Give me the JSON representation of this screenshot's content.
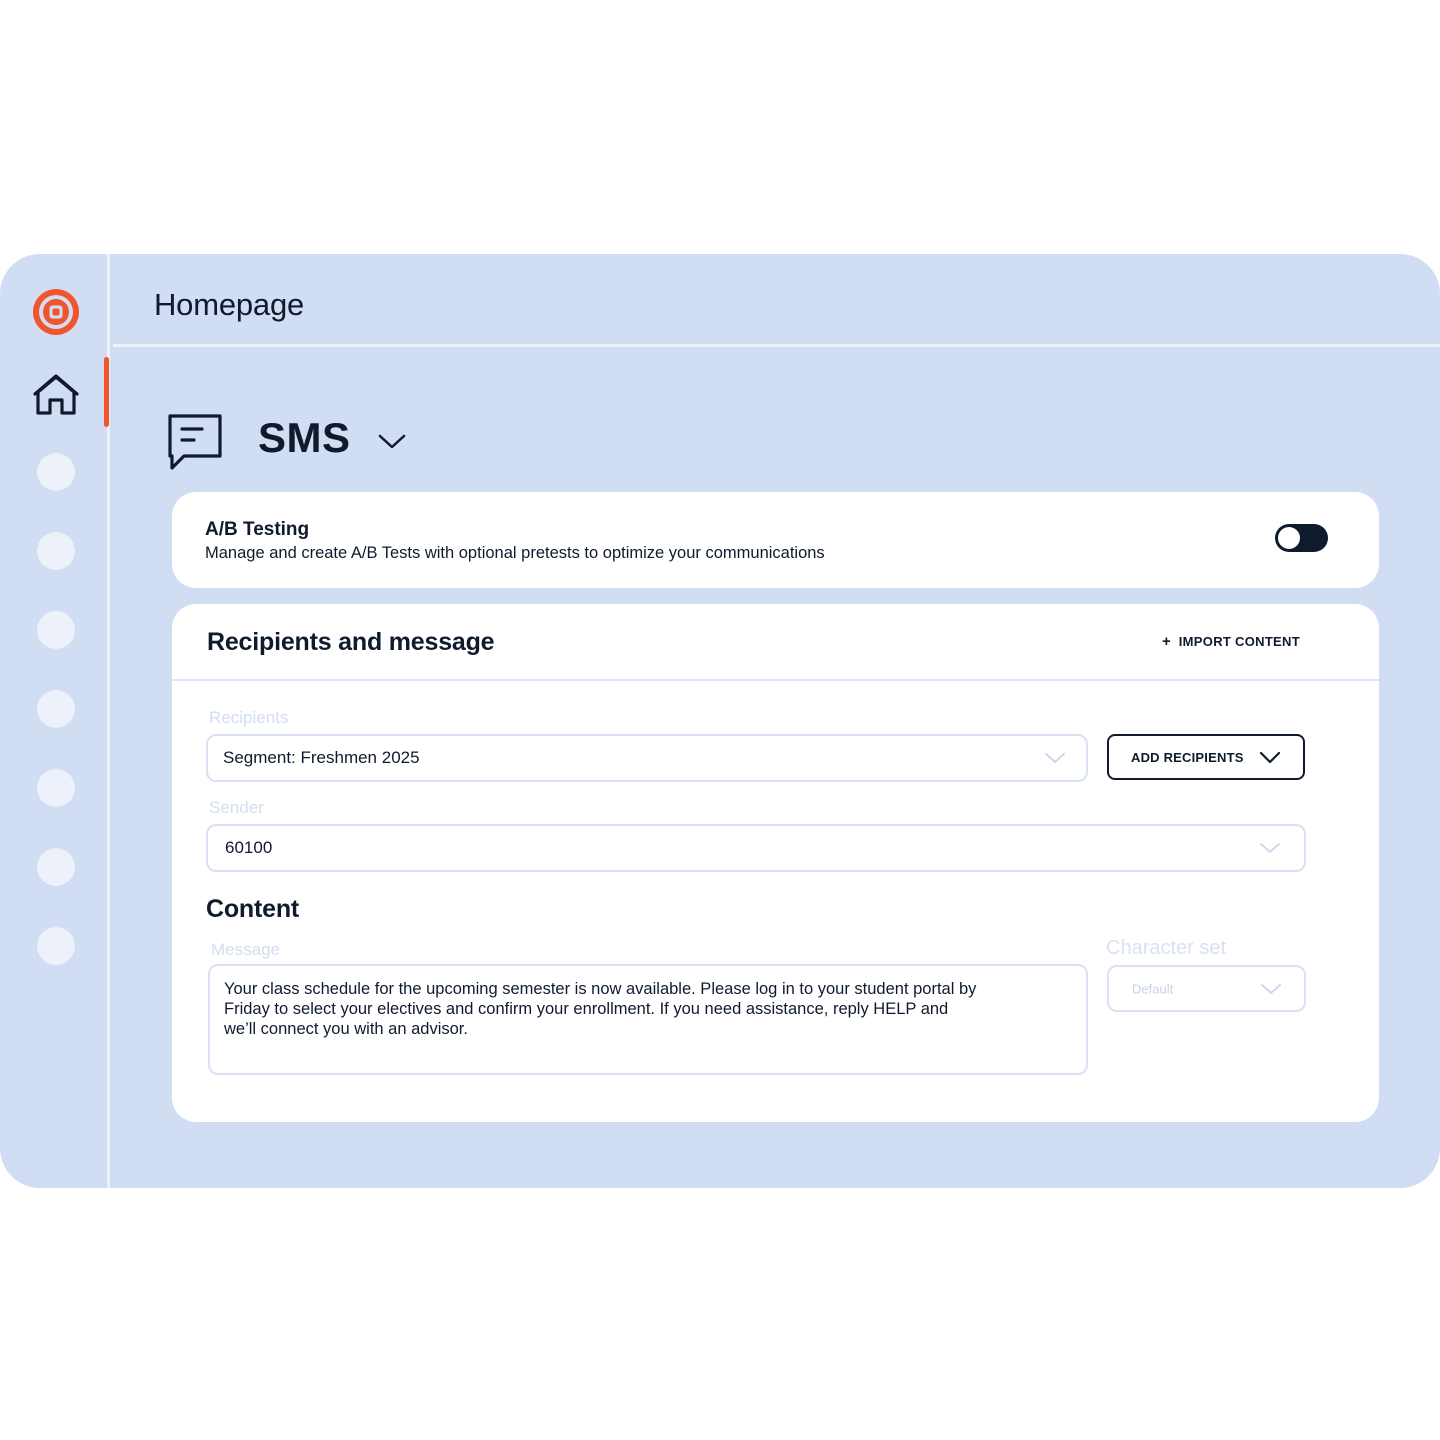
{
  "colors": {
    "frame_bg": "#d1ddf2",
    "accent": "#f0562b",
    "ink": "#0f1b2d",
    "card_bg": "#ffffff",
    "muted": "#d3def0"
  },
  "sidebar": {
    "logo_icon": "target-logo-icon",
    "items": [
      {
        "icon": "home-icon",
        "active": true
      },
      {
        "icon": "placeholder-dot"
      },
      {
        "icon": "placeholder-dot"
      },
      {
        "icon": "placeholder-dot"
      },
      {
        "icon": "placeholder-dot"
      },
      {
        "icon": "placeholder-dot"
      },
      {
        "icon": "placeholder-dot"
      },
      {
        "icon": "placeholder-dot"
      }
    ]
  },
  "header": {
    "title": "Homepage"
  },
  "channel": {
    "icon": "message-square-icon",
    "name": "SMS"
  },
  "ab_testing": {
    "title": "A/B Testing",
    "description": "Manage and create A/B Tests with optional pretests to optimize your communications",
    "enabled": false
  },
  "recipients_card": {
    "title": "Recipients and message",
    "import_button": {
      "icon": "+",
      "label": "IMPORT CONTENT"
    },
    "recipients": {
      "label": "Recipients",
      "value": "Segment: Freshmen 2025"
    },
    "add_recipients_label": "ADD RECIPIENTS",
    "sender": {
      "label": "Sender",
      "value": "60100"
    },
    "content_heading": "Content",
    "message": {
      "label": "Message",
      "value": "Your class schedule for the upcoming semester is now available. Please log in to your student portal by Friday to select your electives and confirm your enrollment. If you need assistance, reply HELP and we’ll connect you with an advisor."
    },
    "character_set": {
      "label": "Character set",
      "value": "Default"
    }
  }
}
